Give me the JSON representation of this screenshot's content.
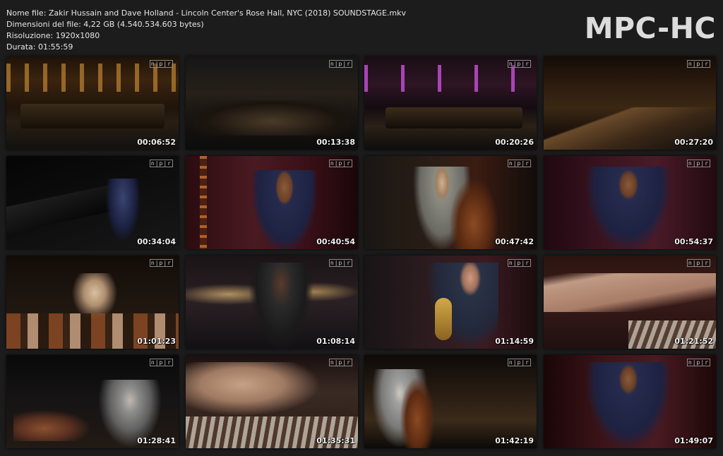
{
  "info": {
    "filename": "Nome file: Zakir Hussain and Dave Holland - Lincoln Center's Rose Hall, NYC (2018) SOUNDSTAGE.mkv",
    "filesize": "Dimensioni del file: 4,22 GB (4.540.534.603 bytes)",
    "resolution": "Risoluzione: 1920x1080",
    "duration": "Durata: 01:55:59"
  },
  "logo": "MPC-HC",
  "watermark": "n|p|r",
  "thumbnails": [
    {
      "time": "00:06:52",
      "scene": "stage-wide"
    },
    {
      "time": "00:13:38",
      "scene": "stage-dark"
    },
    {
      "time": "00:20:26",
      "scene": "stage-purple"
    },
    {
      "time": "00:27:20",
      "scene": "stage-angle"
    },
    {
      "time": "00:34:04",
      "scene": "piano"
    },
    {
      "time": "00:40:54",
      "scene": "singer-red"
    },
    {
      "time": "00:47:42",
      "scene": "bass"
    },
    {
      "time": "00:54:37",
      "scene": "singer-red2"
    },
    {
      "time": "01:01:23",
      "scene": "tabla"
    },
    {
      "time": "01:08:14",
      "scene": "drums"
    },
    {
      "time": "01:14:59",
      "scene": "sax"
    },
    {
      "time": "01:21:52",
      "scene": "hands"
    },
    {
      "time": "01:28:41",
      "scene": "bass-tabla"
    },
    {
      "time": "01:35:31",
      "scene": "hands2"
    },
    {
      "time": "01:42:19",
      "scene": "bass-wide"
    },
    {
      "time": "01:49:07",
      "scene": "singer-red3"
    }
  ]
}
